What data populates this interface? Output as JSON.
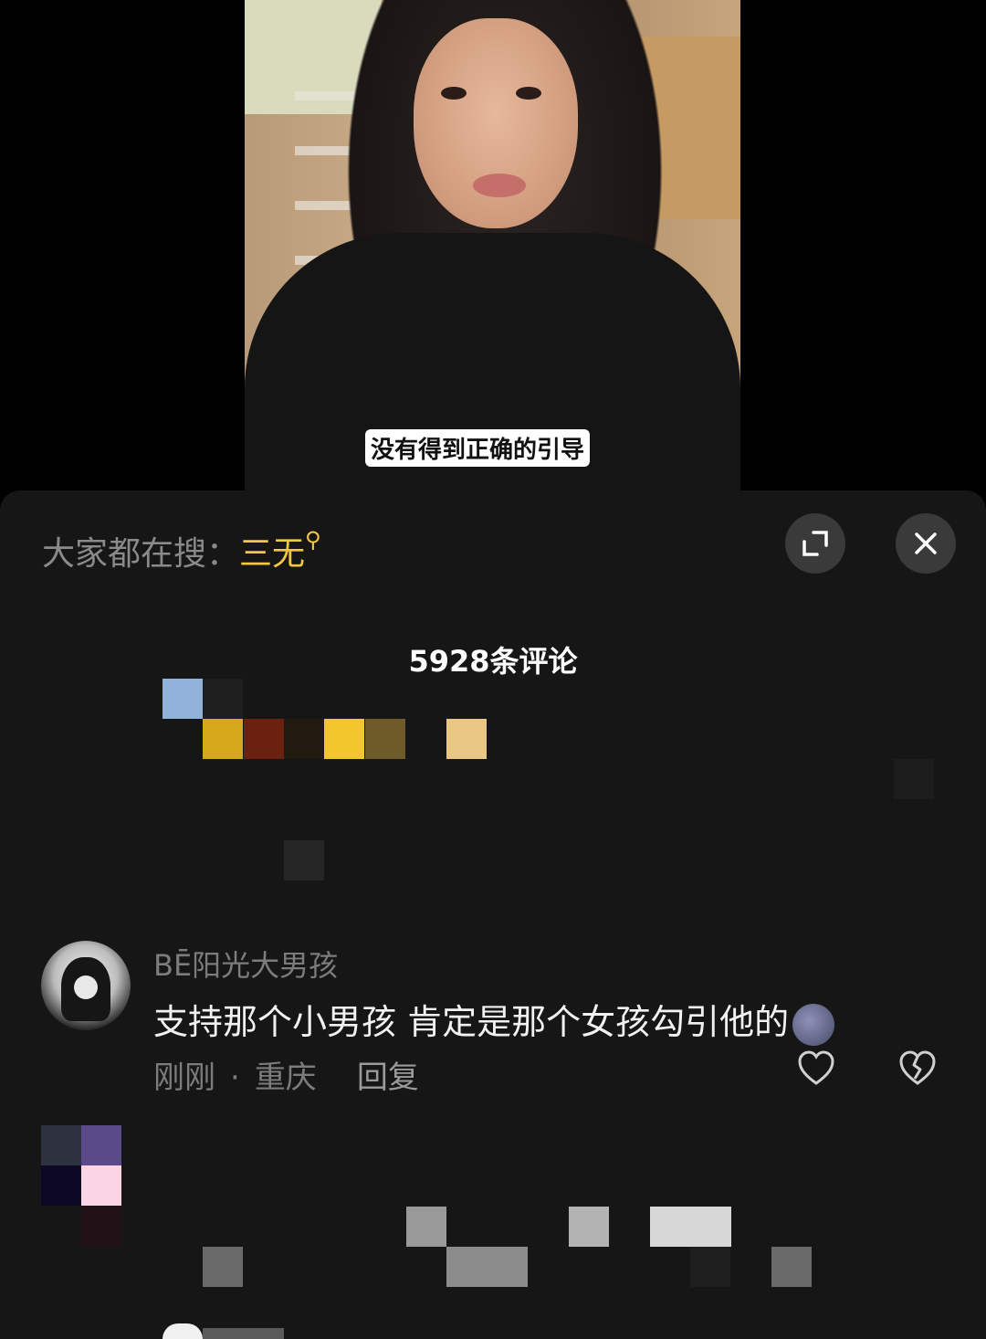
{
  "video": {
    "subtitle": "没有得到正确的引导"
  },
  "search": {
    "prefix": "大家都在搜：",
    "keyword": "三无"
  },
  "header": {
    "comment_count": "5928条评论"
  },
  "comment": {
    "username": "BĒ阳光大男孩",
    "text": "支持那个小男孩 肯定是那个女孩勾引他的",
    "time": "刚刚",
    "separator": "·",
    "location": "重庆",
    "reply_label": "回复",
    "emoji_icon": "new-moon-face-icon",
    "like_icon": "heart-outline-icon",
    "dislike_icon": "broken-heart-icon"
  },
  "colors": {
    "accent": "#f2c744",
    "sheet_bg": "#161616",
    "button_bg": "#3a3a3a"
  }
}
